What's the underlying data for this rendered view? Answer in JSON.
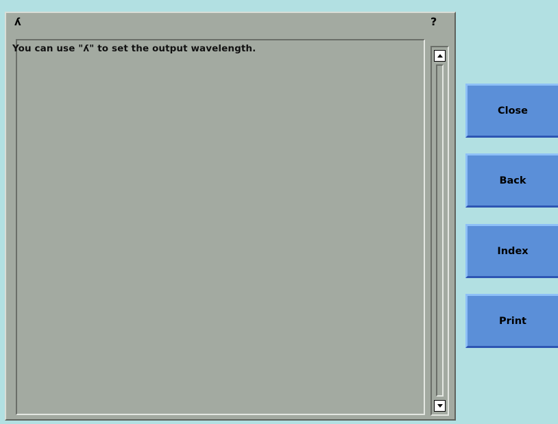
{
  "window": {
    "title": "ʎ",
    "help_glyph": "?"
  },
  "content": {
    "text": "You can use \"ʎ\" to set the output wavelength."
  },
  "buttons": {
    "close": "Close",
    "back": "Back",
    "index": "Index",
    "print": "Print"
  },
  "colors": {
    "background": "#b2e0e2",
    "panel": "#a3aaa1",
    "button": "#5b8fd8"
  }
}
